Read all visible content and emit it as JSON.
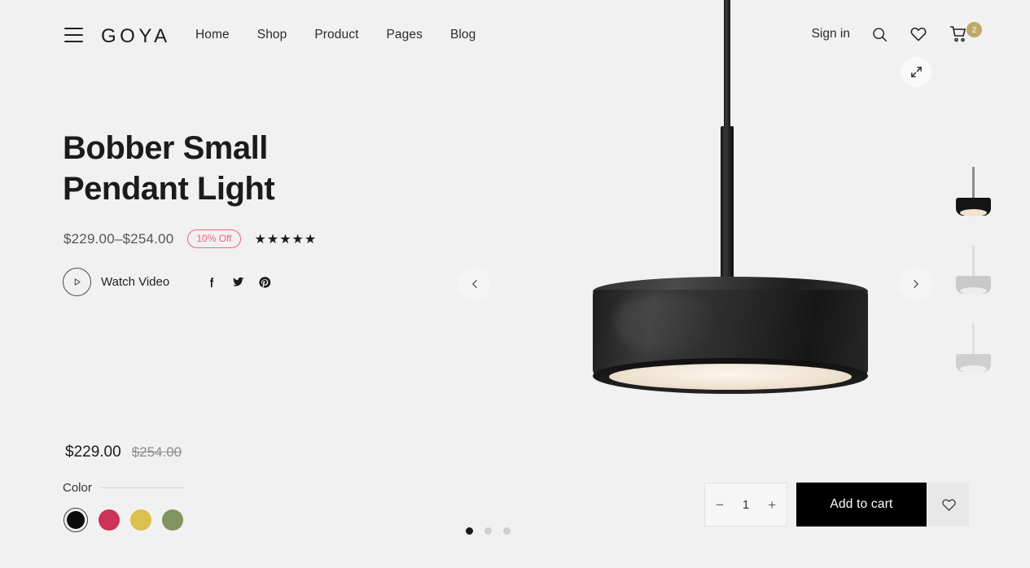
{
  "header": {
    "logo": "GOYA",
    "nav": [
      {
        "label": "Home"
      },
      {
        "label": "Shop"
      },
      {
        "label": "Product"
      },
      {
        "label": "Pages"
      },
      {
        "label": "Blog"
      }
    ],
    "signin": "Sign in",
    "cart_count": "2",
    "cart_badge_color": "#c0a76a"
  },
  "product": {
    "title": "Bobber Small\nPendant Light",
    "title_line1": "Bobber Small",
    "title_line2": "Pendant Light",
    "price_range": "$229.00–$254.00",
    "discount_badge": "10% Off",
    "discount_color": "#f4607b",
    "stars": "★★★★★",
    "rating": 5,
    "watch_video": "Watch Video",
    "socials": [
      "facebook-icon",
      "twitter-icon",
      "pinterest-icon"
    ],
    "sale_price": "$229.00",
    "old_price": "$254.00",
    "color_label": "Color",
    "colors": [
      {
        "name": "black",
        "hex": "#0b0b0b",
        "selected": true
      },
      {
        "name": "crimson",
        "hex": "#cc3356",
        "selected": false
      },
      {
        "name": "gold",
        "hex": "#d9c04f",
        "selected": false
      },
      {
        "name": "olive",
        "hex": "#7f9460",
        "selected": false
      }
    ],
    "quantity": "1",
    "add_to_cart": "Add to cart"
  },
  "gallery": {
    "thumbnails": [
      {
        "name": "black-pendant",
        "shade": "#141414",
        "cord": "#8c8c8c",
        "glow": "#efe3d2",
        "active": true
      },
      {
        "name": "light-gray-pendant",
        "shade": "#c9c9c9",
        "cord": "#dcdcdc",
        "glow": "#ededed",
        "active": false
      },
      {
        "name": "gray-pendant",
        "shade": "#cfcfcf",
        "cord": "#e0e0e0",
        "glow": "#efefef",
        "active": false
      }
    ],
    "dots": [
      {
        "active": true
      },
      {
        "active": false
      },
      {
        "active": false
      }
    ]
  },
  "theme": {
    "background": "#f1f1f1",
    "text": "#1b1b1b"
  }
}
